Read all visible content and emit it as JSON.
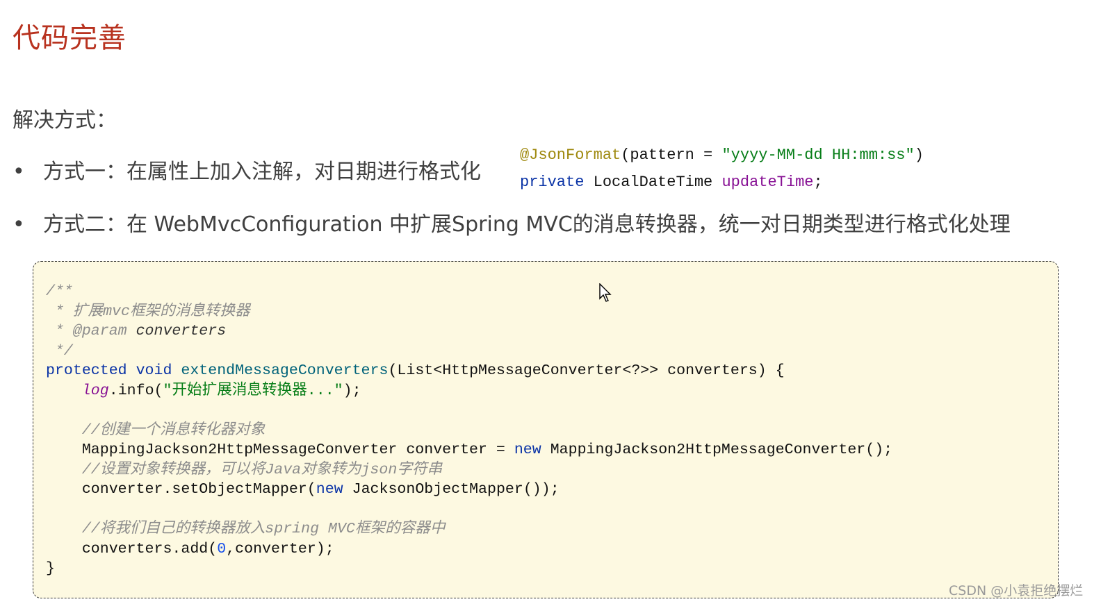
{
  "title": "代码完善",
  "subheading": "解决方式：",
  "bullets": [
    {
      "marker": "•",
      "text": "方式一：在属性上加入注解，对日期进行格式化"
    },
    {
      "marker": "•",
      "text": "方式二：在 WebMvcConfiguration 中扩展Spring MVC的消息转换器，统一对日期类型进行格式化处理"
    }
  ],
  "snippet": {
    "lines": [
      [
        [
          "@JsonFormat",
          "ann"
        ],
        [
          "(pattern = ",
          ""
        ],
        [
          "\"yyyy-MM-dd HH:mm:ss\"",
          "str"
        ],
        [
          ")",
          ""
        ]
      ],
      [
        [
          "private",
          "k"
        ],
        [
          " LocalDateTime ",
          ""
        ],
        [
          "updateTime",
          "pur"
        ],
        [
          ";",
          ""
        ]
      ]
    ]
  },
  "code": {
    "lines": [
      [
        [
          "/**",
          "cm"
        ]
      ],
      [
        [
          " * 扩展mvc框架的消息转换器",
          "cm"
        ]
      ],
      [
        [
          " * @param ",
          "cm"
        ],
        [
          "converters",
          "cmt"
        ]
      ],
      [
        [
          " */",
          "cm"
        ]
      ],
      [
        [
          "protected void ",
          "k"
        ],
        [
          "extendMessageConverters",
          "fn"
        ],
        [
          "(List<HttpMessageConverter<?>> converters) {",
          ""
        ]
      ],
      [
        [
          "    ",
          ""
        ],
        [
          "log",
          "fld"
        ],
        [
          ".info(",
          ""
        ],
        [
          "\"开始扩展消息转换器...\"",
          "str"
        ],
        [
          ");",
          ""
        ]
      ],
      [
        [
          "",
          ""
        ]
      ],
      [
        [
          "    ",
          ""
        ],
        [
          "//创建一个消息转化器对象",
          "cm"
        ]
      ],
      [
        [
          "    MappingJackson2HttpMessageConverter converter = ",
          ""
        ],
        [
          "new",
          "k"
        ],
        [
          " MappingJackson2HttpMessageConverter();",
          ""
        ]
      ],
      [
        [
          "    ",
          ""
        ],
        [
          "//设置对象转换器，可以将Java对象转为json字符串",
          "cm"
        ]
      ],
      [
        [
          "    converter.setObjectMapper(",
          ""
        ],
        [
          "new",
          "k"
        ],
        [
          " JacksonObjectMapper());",
          ""
        ]
      ],
      [
        [
          "",
          ""
        ]
      ],
      [
        [
          "    ",
          ""
        ],
        [
          "//将我们自己的转换器放入spring MVC框架的容器中",
          "cm"
        ]
      ],
      [
        [
          "    converters.add(",
          ""
        ],
        [
          "0",
          "num"
        ],
        [
          ",converter);",
          ""
        ]
      ],
      [
        [
          "}",
          ""
        ]
      ]
    ]
  },
  "watermark": "CSDN @小袁拒绝摆烂",
  "colors": {
    "title": "#b8321f",
    "code_background": "#fdf9e1",
    "keyword": "#0a33a6",
    "string": "#067d17",
    "comment": "#8c8c8c"
  },
  "icons": {
    "cursor": "mouse-pointer-icon"
  }
}
